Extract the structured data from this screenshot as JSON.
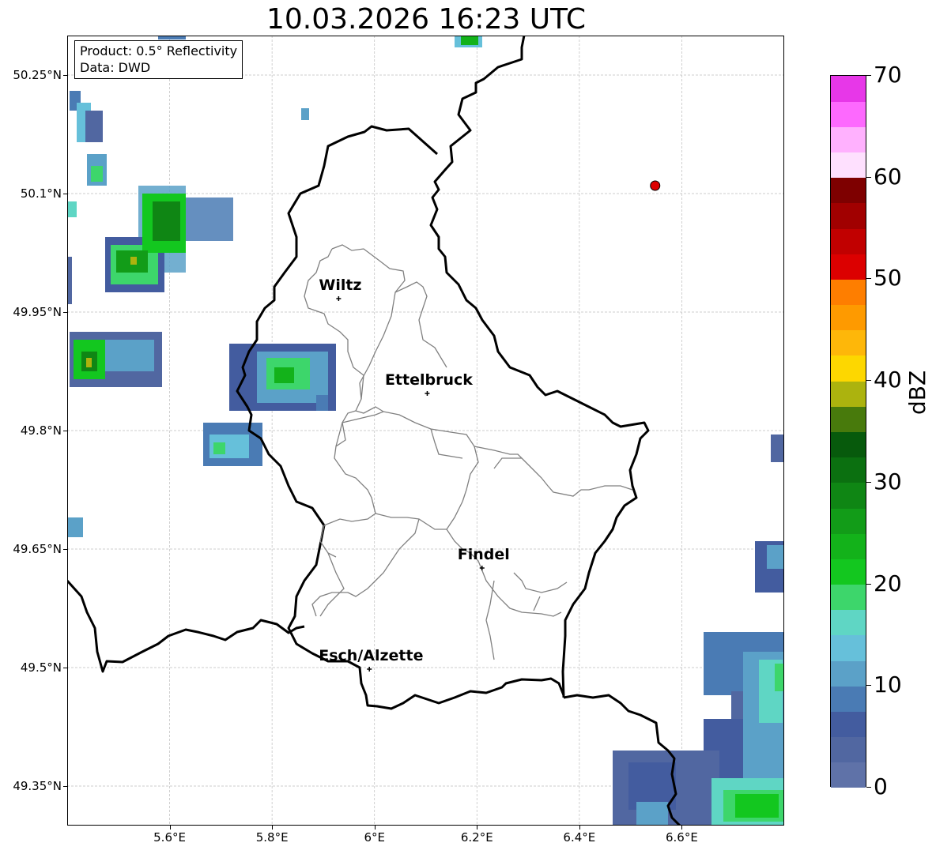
{
  "title": "10.03.2026 16:23 UTC",
  "info_box": {
    "product": "Product: 0.5° Reflectivity",
    "data": "Data: DWD"
  },
  "map": {
    "lon_range": [
      5.4,
      6.8
    ],
    "lat_range": [
      49.3,
      50.3
    ],
    "x_ticks": [
      {
        "lon": 5.6,
        "label": "5.6°E"
      },
      {
        "lon": 5.8,
        "label": "5.8°E"
      },
      {
        "lon": 6.0,
        "label": "6°E"
      },
      {
        "lon": 6.2,
        "label": "6.2°E"
      },
      {
        "lon": 6.4,
        "label": "6.4°E"
      },
      {
        "lon": 6.6,
        "label": "6.6°E"
      }
    ],
    "y_ticks": [
      {
        "lat": 50.25,
        "label": "50.25°N"
      },
      {
        "lat": 50.1,
        "label": "50.1°N"
      },
      {
        "lat": 49.95,
        "label": "49.95°N"
      },
      {
        "lat": 49.8,
        "label": "49.8°N"
      },
      {
        "lat": 49.65,
        "label": "49.65°N"
      },
      {
        "lat": 49.5,
        "label": "49.5°N"
      },
      {
        "lat": 49.35,
        "label": "49.35°N"
      }
    ],
    "cities": [
      {
        "name": "Wiltz",
        "lon": 5.93,
        "lat": 49.967
      },
      {
        "name": "Ettelbruck",
        "lon": 6.103,
        "lat": 49.847
      },
      {
        "name": "Findel",
        "lon": 6.21,
        "lat": 49.626
      },
      {
        "name": "Esch/Alzette",
        "lon": 5.99,
        "lat": 49.498
      }
    ],
    "radar_site": {
      "lon": 6.548,
      "lat": 50.11,
      "color": "#dd0000"
    }
  },
  "colorbar": {
    "label": "dBZ",
    "min": 0,
    "max": 70,
    "ticks": [
      0,
      10,
      20,
      30,
      40,
      50,
      60,
      70
    ],
    "colors": [
      "#5f72a8",
      "#5167a1",
      "#435c9f",
      "#4a7bb4",
      "#5ba1c8",
      "#66c0da",
      "#5fd6c4",
      "#3dd66b",
      "#13c71f",
      "#13b21a",
      "#129c18",
      "#0f8614",
      "#0b7010",
      "#075a0c",
      "#487a0c",
      "#acb30e",
      "#fdd700",
      "#feb709",
      "#fe9a00",
      "#fe7e00",
      "#dc0000",
      "#c10000",
      "#a10000",
      "#7e0000",
      "#fee0fe",
      "#ffb1fe",
      "#fd69fe",
      "#e737e8"
    ]
  }
}
